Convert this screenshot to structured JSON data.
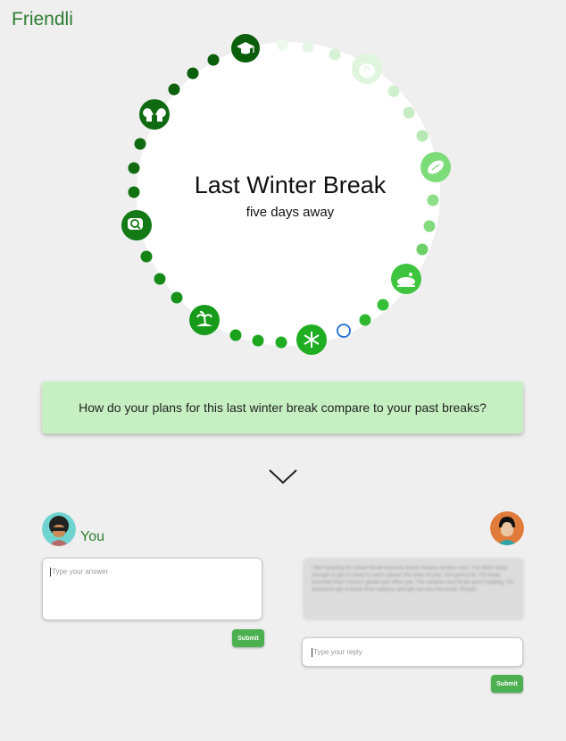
{
  "app": {
    "brand": "Friendli"
  },
  "timeline": {
    "title": "Last Winter Break",
    "subtitle": "five days away",
    "milestone_icons": [
      "graduation-cap-icon",
      "pumpkin-icon",
      "football-icon",
      "turkey-icon",
      "snowflake-icon",
      "palm-island-icon",
      "search-bubble-icon",
      "conversation-heads-icon"
    ],
    "colors": {
      "past_dark": "#0b5e0b",
      "mid": "#1fae22",
      "future": "#7ddc7a",
      "future_faint": "#dff5dd",
      "current_marker": "#1e6fd0"
    }
  },
  "prompt": {
    "question": "How do your plans for this last winter break compare to your past breaks?"
  },
  "you": {
    "label": "You",
    "answer_placeholder": "Type your answer",
    "submit_label": "Submit"
  },
  "friend": {
    "message": "I like traveling for winter break because those Indiana winters suck. I've been lucky enough to get to travel to warm places this time of year. Not gonna lie, I'm kinda bummed that I haven't gotten job offers yet. The weather and finals aren't helping. I'm excited to get a break from campus and get out into the world, though.",
    "reply_placeholder": "Type your reply",
    "submit_label": "Submit"
  }
}
